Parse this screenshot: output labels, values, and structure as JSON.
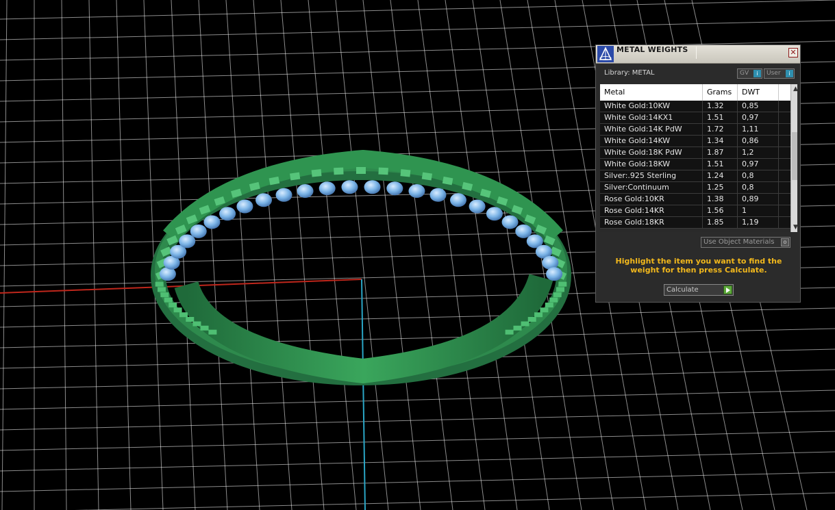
{
  "panel": {
    "title": "METAL WEIGHTS",
    "close_icon": "close-x",
    "library_label": "Library: METAL",
    "toggles": [
      {
        "label": "GV",
        "icon": "info"
      },
      {
        "label": "User",
        "icon": "info"
      }
    ],
    "columns": [
      "Metal",
      "Grams",
      "DWT"
    ],
    "rows": [
      [
        "White Gold:10KW",
        "1.32",
        "0,85"
      ],
      [
        "White Gold:14KX1",
        "1.51",
        "0,97"
      ],
      [
        "White Gold:14K PdW",
        "1.72",
        "1,11"
      ],
      [
        "White Gold:14KW",
        "1.34",
        "0,86"
      ],
      [
        "White Gold:18K PdW",
        "1.87",
        "1,2"
      ],
      [
        "White Gold:18KW",
        "1.51",
        "0,97"
      ],
      [
        "Silver:.925 Sterling",
        "1.24",
        "0,8"
      ],
      [
        "Silver:Continuum",
        "1.25",
        "0,8"
      ],
      [
        "Rose Gold:10KR",
        "1.38",
        "0,89"
      ],
      [
        "Rose Gold:14KR",
        "1.56",
        "1"
      ],
      [
        "Rose Gold:18KR",
        "1.85",
        "1,19"
      ]
    ],
    "use_object_materials": "Use Object Materials",
    "hint": "Highlight the item you want to find the weight for then press Calculate.",
    "calculate_label": "Calculate"
  },
  "colors": {
    "grid": "#ffffff",
    "x_axis": "#c0271c",
    "y_axis": "#2aa6c6",
    "ring_metal": "#3aa65c",
    "stones": "#7ab3e6",
    "hint_text": "#f2b81c",
    "calc_button": "#5da93a"
  }
}
